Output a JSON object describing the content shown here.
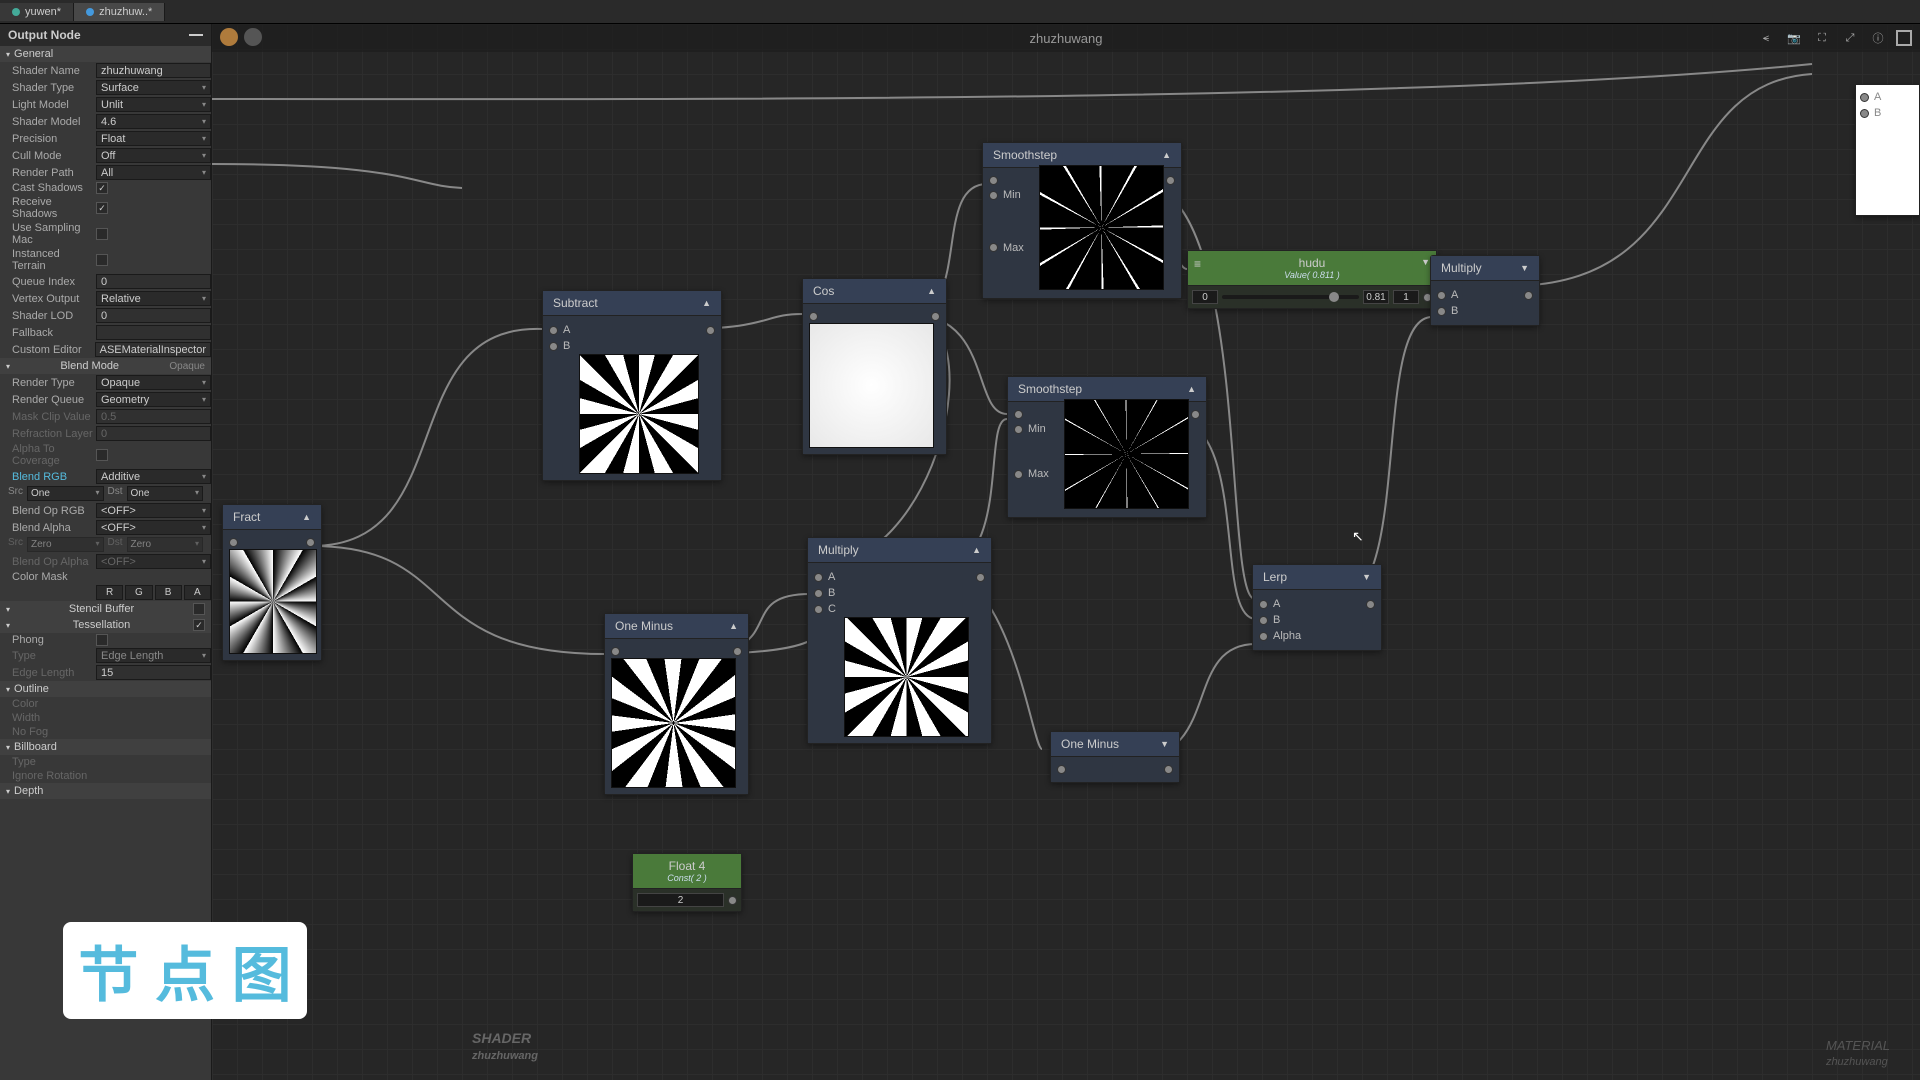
{
  "tabs": [
    {
      "label": "yuwen*",
      "active": false
    },
    {
      "label": "zhuzhuw..*",
      "active": true
    }
  ],
  "sidebar": {
    "title": "Output Node",
    "sections": {
      "general": "General",
      "blendmode": "Blend Mode",
      "blendmode_val": "Opaque",
      "stencil": "Stencil Buffer",
      "tess": "Tessellation",
      "outline": "Outline",
      "billboard": "Billboard",
      "depth": "Depth"
    },
    "props": {
      "shader_name_lbl": "Shader Name",
      "shader_name": "zhuzhuwang",
      "shader_type_lbl": "Shader Type",
      "shader_type": "Surface",
      "light_model_lbl": "Light Model",
      "light_model": "Unlit",
      "shader_model_lbl": "Shader Model",
      "shader_model": "4.6",
      "precision_lbl": "Precision",
      "precision": "Float",
      "cull_lbl": "Cull Mode",
      "cull": "Off",
      "render_path_lbl": "Render Path",
      "render_path": "All",
      "cast_lbl": "Cast Shadows",
      "recv_lbl": "Receive Shadows",
      "sampl_lbl": "Use Sampling Mac",
      "inst_lbl": "Instanced Terrain",
      "queue_idx_lbl": "Queue Index",
      "queue_idx": "0",
      "vout_lbl": "Vertex Output",
      "vout": "Relative",
      "lod_lbl": "Shader LOD",
      "lod": "0",
      "fallback_lbl": "Fallback",
      "fallback": "",
      "custom_lbl": "Custom Editor",
      "custom": "ASEMaterialInspector",
      "rendertype_lbl": "Render Type",
      "rendertype": "Opaque",
      "renderqueue_lbl": "Render Queue",
      "renderqueue": "Geometry",
      "maskclip_lbl": "Mask Clip Value",
      "maskclip": "0.5",
      "refract_lbl": "Refraction Layer",
      "refract": "0",
      "alphacov_lbl": "Alpha To Coverage",
      "blendrgb_lbl": "Blend RGB",
      "blendrgb": "Additive",
      "src_lbl": "Src",
      "src": "One",
      "dst_lbl": "Dst",
      "dst": "One",
      "blendoprgb_lbl": "Blend Op RGB",
      "blendoprgb": "<OFF>",
      "blendalpha_lbl": "Blend Alpha",
      "blendalpha": "<OFF>",
      "src2": "Zero",
      "dst2": "Zero",
      "blendopalpha_lbl": "Blend Op Alpha",
      "blendopalpha": "<OFF>",
      "colormask_lbl": "Color Mask",
      "phong_lbl": "Phong",
      "typetess_lbl": "Type",
      "typetess": "Edge Length",
      "edgelen_lbl": "Edge Length",
      "edgelen": "15",
      "color_lbl": "Color",
      "width_lbl": "Width",
      "nofog_lbl": "No Fog",
      "type2_lbl": "Type",
      "ignorerot_lbl": "Ignore Rotation"
    }
  },
  "canvas": {
    "title": "zhuzhuwang",
    "bottom_shader": "SHADER",
    "bottom_name": "zhuzhuwang",
    "bottom_material": "MATERIAL"
  },
  "nodes": {
    "fract": {
      "title": "Fract"
    },
    "subtract": {
      "title": "Subtract",
      "a": "A",
      "b": "B"
    },
    "oneminus1": {
      "title": "One Minus"
    },
    "cos": {
      "title": "Cos"
    },
    "multiply1": {
      "title": "Multiply",
      "a": "A",
      "b": "B",
      "c": "C"
    },
    "float4": {
      "title": "Float 4",
      "sub": "Const( 2 )",
      "val": "2"
    },
    "smooth1": {
      "title": "Smoothstep",
      "min": "Min",
      "max": "Max"
    },
    "smooth2": {
      "title": "Smoothstep",
      "min": "Min",
      "max": "Max"
    },
    "oneminus2": {
      "title": "One Minus"
    },
    "hudu": {
      "title": "hudu",
      "sub": "Value( 0.811 )",
      "min": "0",
      "val": "0.81",
      "max": "1"
    },
    "lerp": {
      "title": "Lerp",
      "a": "A",
      "b": "B",
      "alpha": "Alpha"
    },
    "multiply2": {
      "title": "Multiply",
      "a": "A",
      "b": "B"
    },
    "ab": {
      "a": "A",
      "b": "B"
    }
  },
  "watermark": "节 点 图"
}
